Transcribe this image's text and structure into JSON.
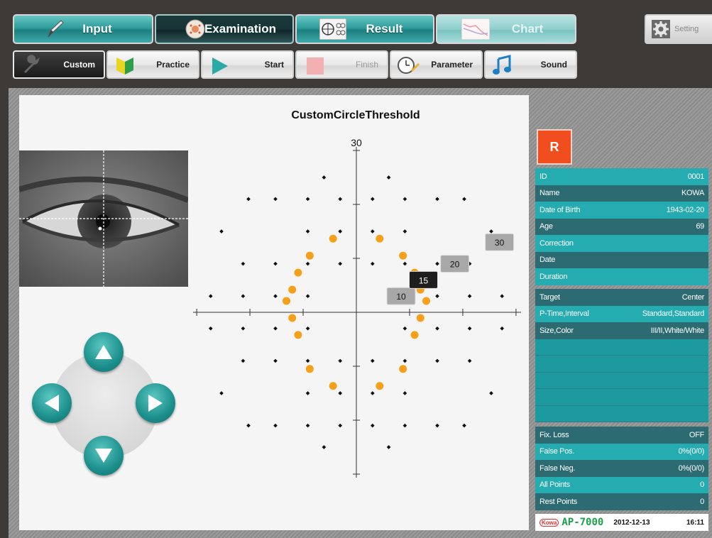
{
  "nav": {
    "tabs": [
      {
        "label": "Input"
      },
      {
        "label": "Examination"
      },
      {
        "label": "Result"
      },
      {
        "label": "Chart"
      }
    ],
    "setting_label": "Setting"
  },
  "toolbar": {
    "buttons": [
      {
        "label": "Custom"
      },
      {
        "label": "Practice"
      },
      {
        "label": "Start"
      },
      {
        "label": "Finish"
      },
      {
        "label": "Parameter"
      },
      {
        "label": "Sound"
      }
    ]
  },
  "chart_data": {
    "type": "scatter",
    "title": "CustomCircleThreshold",
    "axis_label_top": "30",
    "ring_labels": [
      "10",
      "15",
      "20",
      "30"
    ],
    "test_points": [
      [
        -9,
        3
      ],
      [
        -9,
        -3
      ],
      [
        -3,
        9
      ],
      [
        3,
        9
      ],
      [
        9,
        3
      ],
      [
        9,
        -3
      ],
      [
        -3,
        -9
      ],
      [
        3,
        -9
      ],
      [
        -15,
        3
      ],
      [
        -15,
        -3
      ],
      [
        -3,
        15
      ],
      [
        3,
        15
      ],
      [
        15,
        3
      ],
      [
        15,
        -3
      ],
      [
        -3,
        -15
      ],
      [
        3,
        -15
      ],
      [
        -21,
        3
      ],
      [
        -21,
        -3
      ],
      [
        -9,
        9
      ],
      [
        9,
        9
      ],
      [
        21,
        3
      ],
      [
        21,
        -3
      ],
      [
        -9,
        -9
      ],
      [
        9,
        -9
      ],
      [
        -15,
        9
      ],
      [
        15,
        9
      ],
      [
        -15,
        -9
      ],
      [
        15,
        -9
      ],
      [
        -9,
        15
      ],
      [
        9,
        15
      ],
      [
        -9,
        -15
      ],
      [
        9,
        -15
      ],
      [
        -27,
        3
      ],
      [
        -27,
        -3
      ],
      [
        27,
        3
      ],
      [
        27,
        -3
      ],
      [
        -21,
        9
      ],
      [
        21,
        9
      ],
      [
        -21,
        -9
      ],
      [
        21,
        -9
      ],
      [
        -25,
        15
      ],
      [
        25,
        15
      ],
      [
        -25,
        -15
      ],
      [
        25,
        -15
      ],
      [
        -15,
        21
      ],
      [
        15,
        21
      ],
      [
        -15,
        -21
      ],
      [
        15,
        -21
      ],
      [
        -6,
        25
      ],
      [
        6,
        25
      ],
      [
        -6,
        -25
      ],
      [
        6,
        -25
      ],
      [
        -20,
        21
      ],
      [
        20,
        21
      ],
      [
        -20,
        -21
      ],
      [
        20,
        -21
      ],
      [
        -9,
        21
      ],
      [
        9,
        21
      ],
      [
        -9,
        -21
      ],
      [
        9,
        -21
      ],
      [
        -3,
        21
      ],
      [
        3,
        21
      ],
      [
        -3,
        -21
      ],
      [
        3,
        -21
      ]
    ],
    "custom_points": [
      [
        -11,
        4
      ],
      [
        -11,
        -1
      ],
      [
        -10,
        7
      ],
      [
        -10,
        -4
      ],
      [
        -8,
        -10
      ],
      [
        -8,
        10
      ],
      [
        -4,
        13
      ],
      [
        -4,
        -13
      ],
      [
        4,
        13
      ],
      [
        4,
        -13
      ],
      [
        8,
        10
      ],
      [
        8,
        -10
      ],
      [
        10,
        7
      ],
      [
        10,
        -4
      ],
      [
        11,
        4
      ],
      [
        11,
        -1
      ],
      [
        -12,
        2
      ],
      [
        12,
        2
      ]
    ]
  },
  "patient": {
    "eye": "R",
    "rows": [
      {
        "label": "ID",
        "value": "0001"
      },
      {
        "label": "Name",
        "value": "KOWA"
      },
      {
        "label": "Date of Birth",
        "value": "1943-02-20"
      },
      {
        "label": "Age",
        "value": "69"
      },
      {
        "label": "Correction",
        "value": ""
      },
      {
        "label": "Date",
        "value": ""
      },
      {
        "label": "Duration",
        "value": ""
      }
    ],
    "exam_rows": [
      {
        "label": "Target",
        "value": "Center"
      },
      {
        "label": "P-Time,Interval",
        "value": "Standard,Standard"
      },
      {
        "label": "Size,Color",
        "value": "III/II,White/White"
      }
    ],
    "stat_rows": [
      {
        "label": "Fix. Loss",
        "value": "OFF"
      },
      {
        "label": "False Pos.",
        "value": "0%(0/0)"
      },
      {
        "label": "False Neg.",
        "value": "0%(0/0)"
      },
      {
        "label": "All Points",
        "value": "0"
      },
      {
        "label": "Rest Points",
        "value": "0"
      }
    ]
  },
  "footer": {
    "logo": "Kowa",
    "brand": "AP-7000",
    "date": "2012-12-13",
    "time": "16:11"
  },
  "colors": {
    "teal": "#2e9d9c",
    "custom_point": "#f5a018",
    "eye_tag": "#f04e1f"
  }
}
